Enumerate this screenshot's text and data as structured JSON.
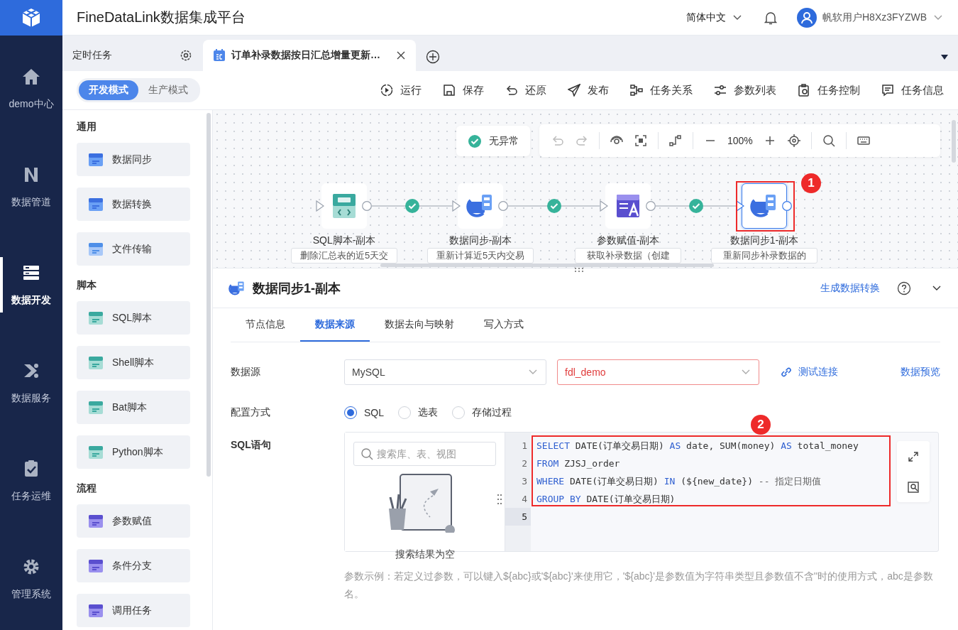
{
  "app": {
    "title": "FineDataLink数据集成平台"
  },
  "header": {
    "language": "简体中文",
    "user": "帆软用户H8Xz3FYZWB"
  },
  "nav": [
    {
      "label": "demo中心",
      "selected": false
    },
    {
      "label": "数据管道",
      "selected": false
    },
    {
      "label": "数据开发",
      "selected": true
    },
    {
      "label": "数据服务",
      "selected": false
    },
    {
      "label": "任务运维",
      "selected": false
    },
    {
      "label": "管理系统",
      "selected": false
    }
  ],
  "tabs": [
    {
      "label": "定时任务",
      "kind": "folder",
      "selected": false
    },
    {
      "label": "订单补录数据按日汇总增量更新…",
      "kind": "task",
      "selected": true
    }
  ],
  "modes": [
    {
      "label": "开发模式",
      "selected": true
    },
    {
      "label": "生产模式",
      "selected": false
    }
  ],
  "toolbar": [
    "运行",
    "保存",
    "还原",
    "发布",
    "任务关系",
    "参数列表",
    "任务控制",
    "任务信息"
  ],
  "palette": [
    {
      "title": "通用",
      "items": [
        "数据同步",
        "数据转换",
        "文件传输"
      ]
    },
    {
      "title": "脚本",
      "items": [
        "SQL脚本",
        "Shell脚本",
        "Bat脚本",
        "Python脚本"
      ]
    },
    {
      "title": "流程",
      "items": [
        "参数赋值",
        "条件分支",
        "调用任务"
      ]
    }
  ],
  "canvas": {
    "status": "无异常",
    "zoom": "100%",
    "nodes": [
      {
        "label": "SQL脚本-副本",
        "description": "删除汇总表的近5天交",
        "selected": false
      },
      {
        "label": "数据同步-副本",
        "description": "重新计算近5天内交易",
        "selected": false
      },
      {
        "label": "参数赋值-副本",
        "description": "获取补录数据（创建",
        "selected": false
      },
      {
        "label": "数据同步1-副本",
        "description": "重新同步补录数据的",
        "selected": true,
        "callout": "1"
      }
    ]
  },
  "panel": {
    "title": "数据同步1-副本",
    "action": "生成数据转换",
    "tabs": [
      {
        "label": "节点信息",
        "selected": false
      },
      {
        "label": "数据来源",
        "selected": true
      },
      {
        "label": "数据去向与映射",
        "selected": false
      },
      {
        "label": "写入方式",
        "selected": false
      }
    ],
    "source": {
      "label": "数据源",
      "type": "MySQL",
      "connection": "fdl_demo",
      "connection_error": true,
      "test": "测试连接",
      "preview": "数据预览"
    },
    "mode": {
      "label": "配置方式",
      "options": [
        {
          "label": "SQL",
          "selected": true
        },
        {
          "label": "选表",
          "selected": false
        },
        {
          "label": "存储过程",
          "selected": false
        }
      ]
    },
    "sql": {
      "label": "SQL语句",
      "search_placeholder": "搜索库、表、视图",
      "empty": "搜索结果为空",
      "callout": "2",
      "gutter": [
        {
          "number": "1",
          "selected": false
        },
        {
          "number": "2",
          "selected": false
        },
        {
          "number": "3",
          "selected": false
        },
        {
          "number": "4",
          "selected": false
        },
        {
          "number": "5",
          "selected": true
        }
      ],
      "lines": [
        [
          {
            "kind": "keyword",
            "text": "SELECT"
          },
          {
            "kind": "plain",
            "text": " DATE(订单交易日期) "
          },
          {
            "kind": "keyword",
            "text": "AS"
          },
          {
            "kind": "plain",
            "text": " date, SUM(money) "
          },
          {
            "kind": "keyword",
            "text": "AS"
          },
          {
            "kind": "plain",
            "text": " total_money"
          }
        ],
        [
          {
            "kind": "keyword",
            "text": "FROM"
          },
          {
            "kind": "plain",
            "text": " ZJSJ_order"
          }
        ],
        [
          {
            "kind": "keyword",
            "text": "WHERE"
          },
          {
            "kind": "plain",
            "text": " DATE(订单交易日期) "
          },
          {
            "kind": "keyword",
            "text": "IN"
          },
          {
            "kind": "plain",
            "text": " (${new_date}) "
          },
          {
            "kind": "comment",
            "text": "-- 指定日期值"
          }
        ],
        [
          {
            "kind": "keyword",
            "text": "GROUP BY"
          },
          {
            "kind": "plain",
            "text": " DATE(订单交易日期)"
          }
        ]
      ]
    },
    "hint": "参数示例：若定义过参数，可以键入${abc}或'${abc}'来使用它，'${abc}'是参数值为字符串类型且参数值不含''时的使用方式，abc是参数名。"
  }
}
